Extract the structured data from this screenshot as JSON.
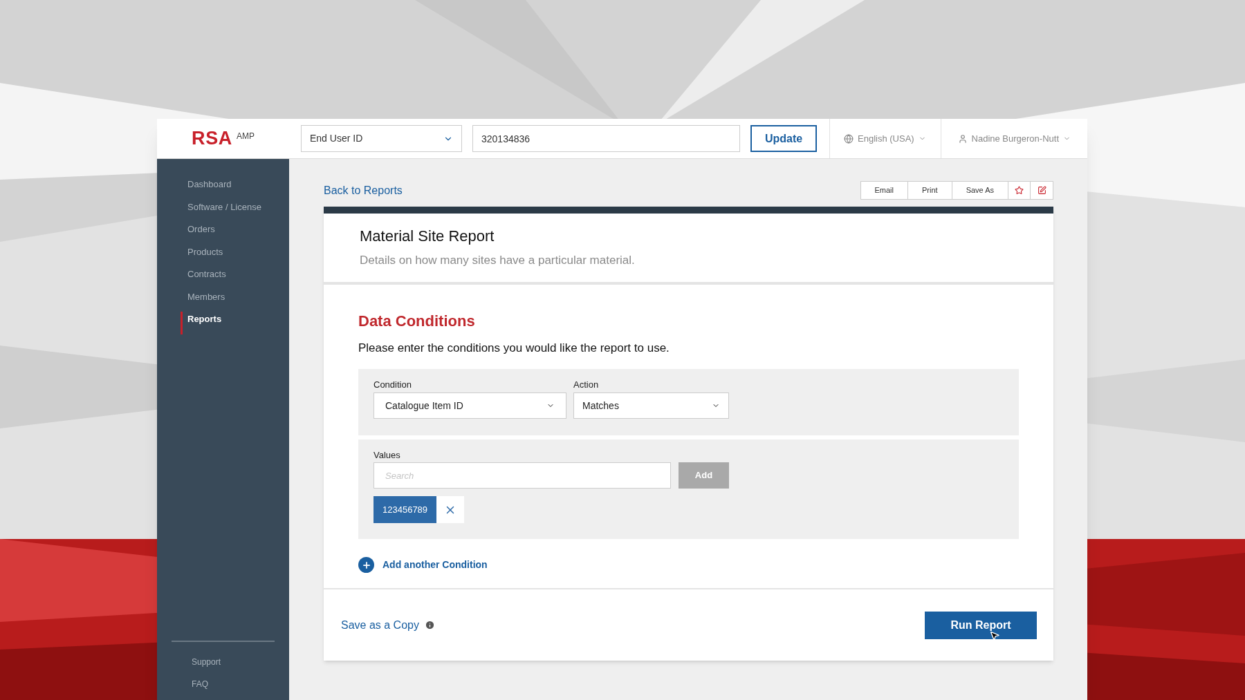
{
  "header": {
    "logo": "RSA",
    "logo_suffix": "AMP",
    "id_type": "End User ID",
    "id_value": "320134836",
    "update_button": "Update",
    "language": "English (USA)",
    "user": "Nadine Burgeron-Nutt"
  },
  "sidebar": {
    "items": [
      {
        "label": "Dashboard",
        "selected": false
      },
      {
        "label": "Software / License",
        "selected": false
      },
      {
        "label": "Orders",
        "selected": false
      },
      {
        "label": "Products",
        "selected": false
      },
      {
        "label": "Contracts",
        "selected": false
      },
      {
        "label": "Members",
        "selected": false
      },
      {
        "label": "Reports",
        "selected": true
      }
    ],
    "footer_links": [
      "Support",
      "FAQ"
    ]
  },
  "back_link": "Back to Reports",
  "toolbar": [
    "Email",
    "Print",
    "Save As"
  ],
  "report": {
    "title": "Material Site Report",
    "subtitle": "Details on how many sites have a particular material."
  },
  "conditions": {
    "heading": "Data Conditions",
    "instructions": "Please enter the conditions you would like the report to use.",
    "condition_label": "Condition",
    "condition_value": "Catalogue Item ID",
    "action_label": "Action",
    "action_value": "Matches",
    "values_label": "Values",
    "search_placeholder": "Search",
    "add_button": "Add",
    "tags": [
      "123456789"
    ],
    "add_condition": "Add another Condition"
  },
  "footer": {
    "save_copy": "Save as a Copy",
    "run_button": "Run Report"
  }
}
